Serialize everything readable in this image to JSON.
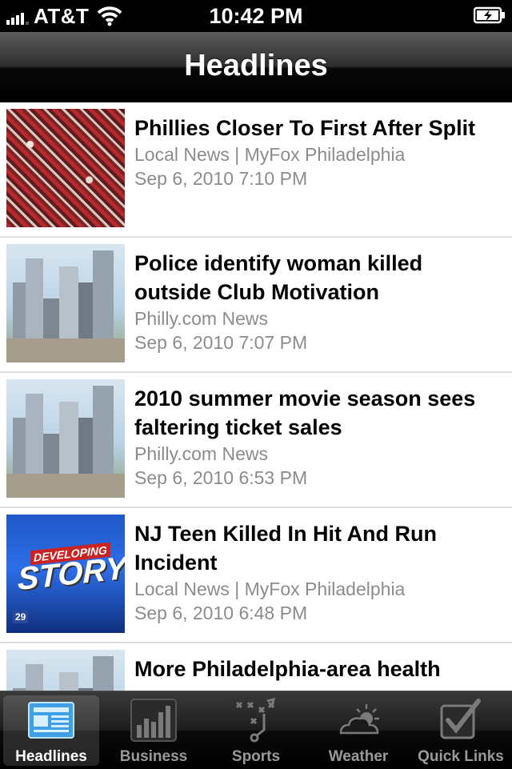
{
  "status_bar": {
    "carrier": "AT&T",
    "time": "10:42 PM"
  },
  "nav": {
    "title": "Headlines"
  },
  "news": [
    {
      "headline": "Phillies Closer To First After Split",
      "source": "Local News | MyFox Philadelphia",
      "date": "Sep 6, 2010 7:10 PM",
      "thumb": "crowd"
    },
    {
      "headline": "Police identify woman killed outside Club Motivation",
      "source": "Philly.com News",
      "date": "Sep 6, 2010 7:07 PM",
      "thumb": "city"
    },
    {
      "headline": "2010 summer movie season sees faltering ticket sales",
      "source": "Philly.com News",
      "date": "Sep 6, 2010 6:53 PM",
      "thumb": "city"
    },
    {
      "headline": "NJ Teen Killed In Hit And Run Incident",
      "source": "Local News | MyFox Philadelphia",
      "date": "Sep 6, 2010 6:48 PM",
      "thumb": "story",
      "thumb_text": "STORY",
      "thumb_banner": "DEVELOPING",
      "thumb_channel": "29"
    },
    {
      "headline": "More Philadelphia-area health",
      "thumb": "city"
    }
  ],
  "tabs": [
    {
      "label": "Headlines",
      "icon": "newspaper-icon",
      "active": true
    },
    {
      "label": "Business",
      "icon": "bar-chart-icon",
      "active": false
    },
    {
      "label": "Sports",
      "icon": "playbook-icon",
      "active": false
    },
    {
      "label": "Weather",
      "icon": "cloud-sun-icon",
      "active": false
    },
    {
      "label": "Quick Links",
      "icon": "checkbox-icon",
      "active": false
    }
  ],
  "colors": {
    "accent": "#3fa0e8",
    "meta_text": "#8c8c8c",
    "divider": "#dedede"
  }
}
